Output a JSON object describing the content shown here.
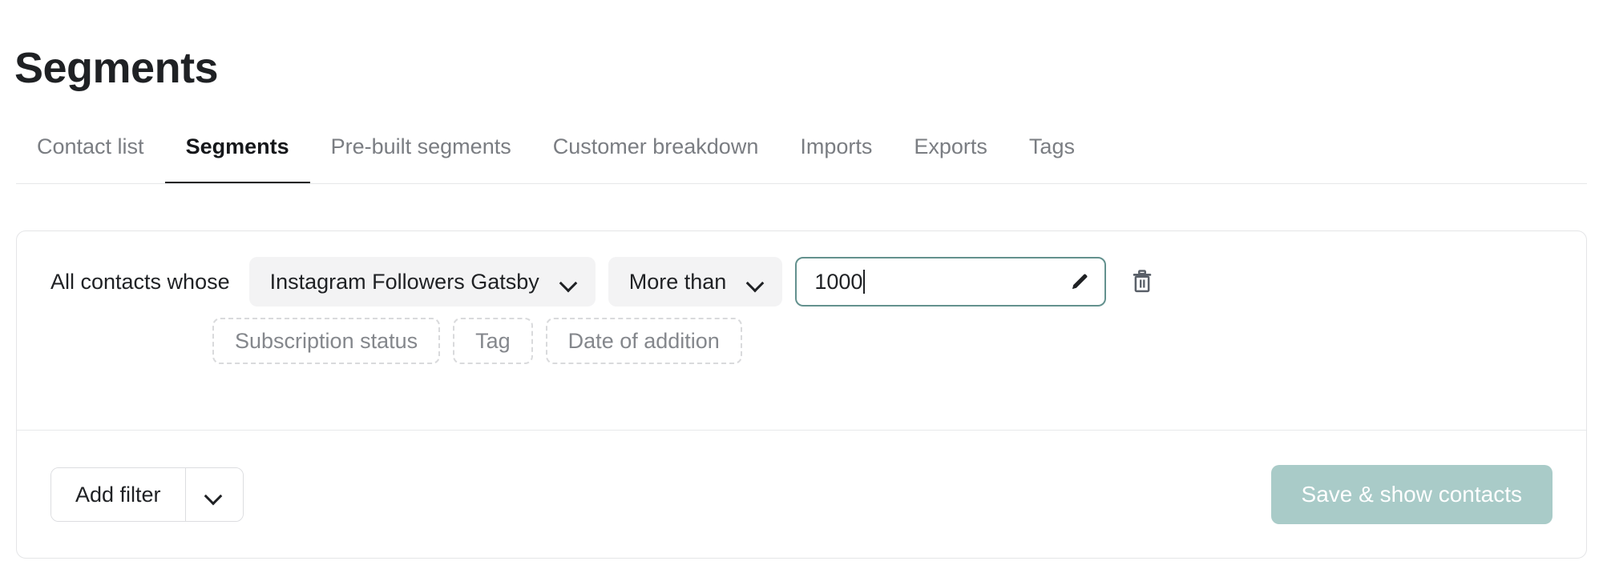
{
  "page": {
    "title": "Segments"
  },
  "tabs": {
    "active_index": 1,
    "items": [
      {
        "label": "Contact list"
      },
      {
        "label": "Segments"
      },
      {
        "label": "Pre-built segments"
      },
      {
        "label": "Customer breakdown"
      },
      {
        "label": "Imports"
      },
      {
        "label": "Exports"
      },
      {
        "label": "Tags"
      }
    ]
  },
  "filter_card": {
    "prefix_label": "All contacts whose",
    "field_select": {
      "value": "Instagram Followers Gatsby",
      "icon": "chevron-down-icon"
    },
    "operator_select": {
      "value": "More than",
      "icon": "chevron-down-icon"
    },
    "value_input": {
      "value": "1000",
      "placeholder": "",
      "edit_icon": "pencil-icon",
      "focused": true,
      "border_color": "#63918e"
    },
    "delete_icon": "trash-icon",
    "suggestion_chips": [
      {
        "label": "Subscription status"
      },
      {
        "label": "Tag"
      },
      {
        "label": "Date of addition"
      }
    ]
  },
  "footer": {
    "add_filter": {
      "label": "Add filter",
      "toggle_icon": "chevron-down-icon"
    },
    "save_button": {
      "label": "Save & show contacts",
      "background_color": "#a9cbc8",
      "text_color": "#ffffff"
    }
  }
}
